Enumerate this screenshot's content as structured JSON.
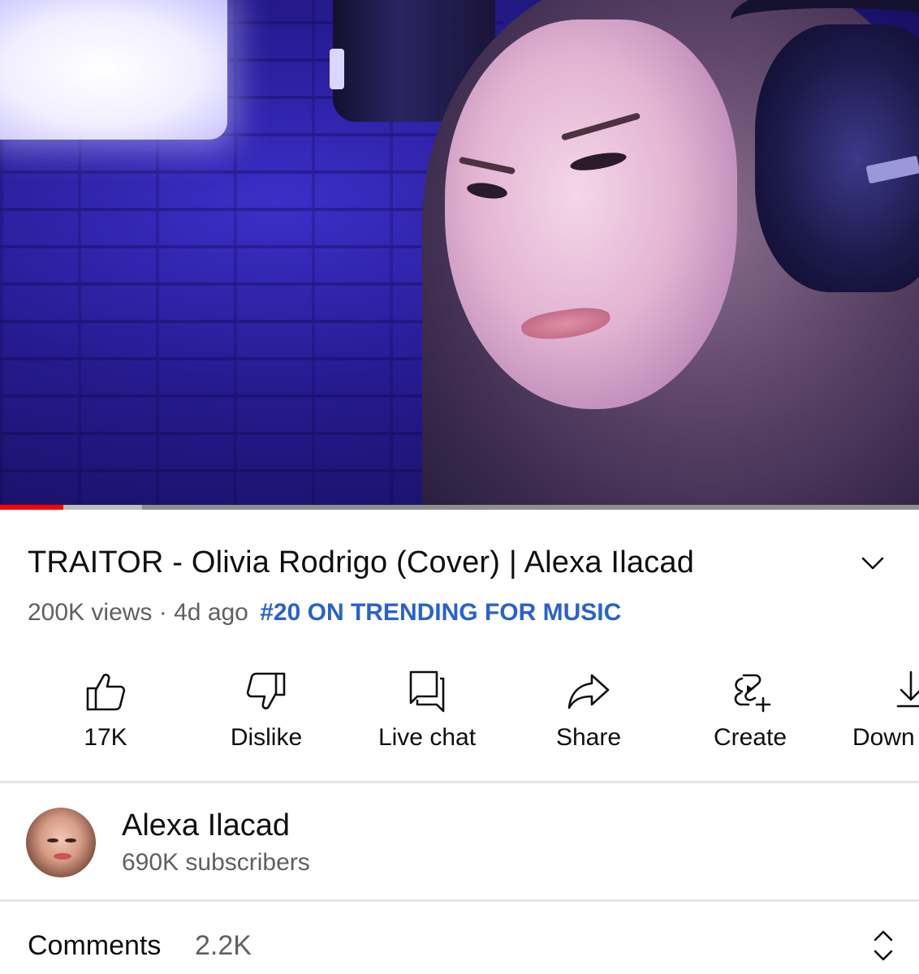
{
  "video": {
    "progress_played": 0.069,
    "progress_buffered": 0.155,
    "colors": {
      "played": "#ff0000",
      "buffer": "#bdbdbd",
      "track": "#8e8e8e"
    }
  },
  "title": "TRAITOR - Olivia Rodrigo (Cover) | Alexa Ilacad",
  "meta": {
    "views": "200K views",
    "separator": "·",
    "age": "4d ago",
    "trending": "#20 ON TRENDING FOR MUSIC",
    "trending_color": "#2b62c8"
  },
  "actions": {
    "like": {
      "label": "17K",
      "icon": "thumbs-up-icon"
    },
    "dislike": {
      "label": "Dislike",
      "icon": "thumbs-down-icon"
    },
    "live_chat": {
      "label": "Live chat",
      "icon": "chat-icon"
    },
    "share": {
      "label": "Share",
      "icon": "share-arrow-icon"
    },
    "create": {
      "label": "Create",
      "icon": "create-icon"
    },
    "download": {
      "label": "Down",
      "icon": "download-icon"
    }
  },
  "channel": {
    "name": "Alexa Ilacad",
    "subscribers": "690K subscribers"
  },
  "comments": {
    "label": "Comments",
    "count": "2.2K"
  }
}
